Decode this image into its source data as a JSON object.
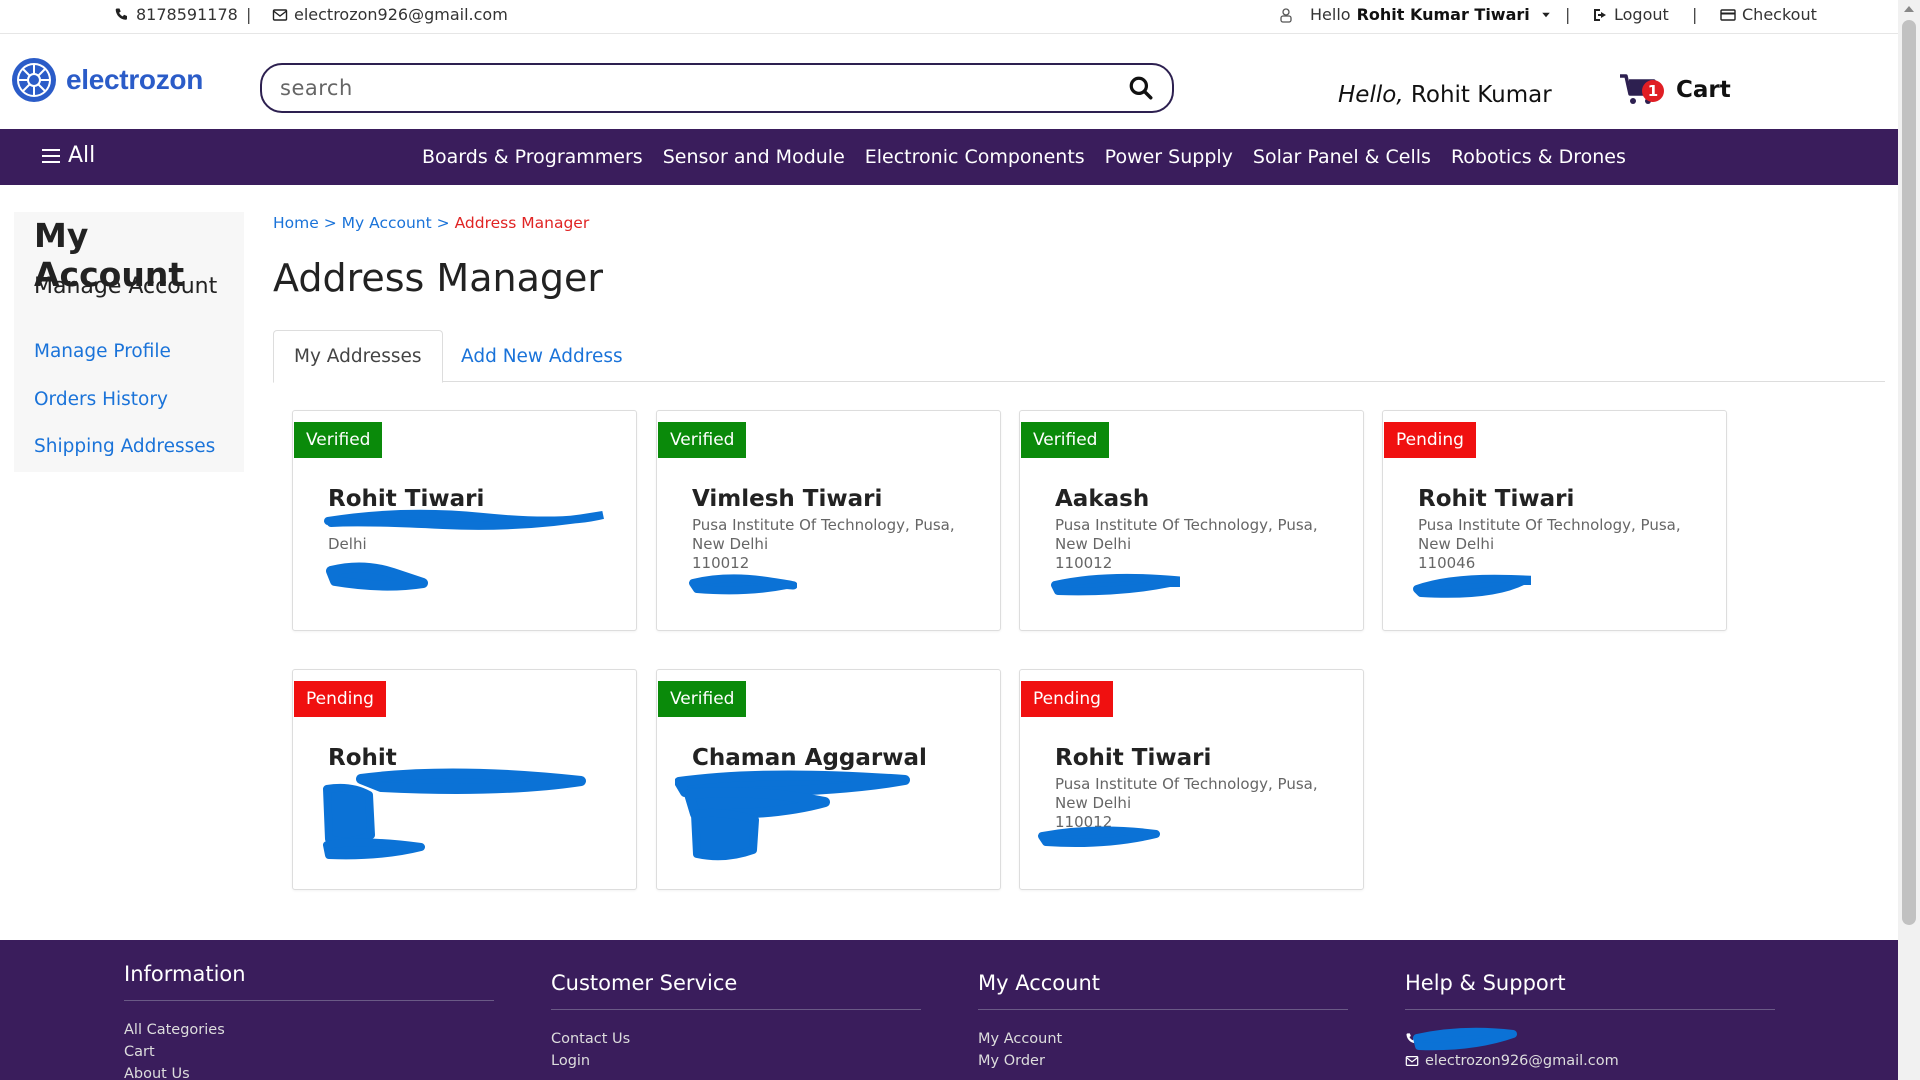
{
  "topbar": {
    "phone": "8178591178",
    "email": "electrozon926@gmail.com",
    "hello_prefix": "Hello",
    "user_name": "Rohit Kumar Tiwari",
    "logout": "Logout",
    "checkout": "Checkout"
  },
  "header": {
    "logo_text": "electrozon",
    "search_placeholder": "search",
    "hello_italic": "Hello,",
    "hello_name": "Rohit Kumar",
    "cart_count": "1",
    "cart_label": "Cart"
  },
  "nav": {
    "all_label": "All",
    "links": [
      "Boards & Programmers",
      "Sensor and Module",
      "Electronic Components",
      "Power Supply",
      "Solar Panel & Cells",
      "Robotics & Drones"
    ]
  },
  "sidebar": {
    "title": "My Account",
    "subtitle": "Manage Account",
    "links": [
      "Manage Profile",
      "Orders History",
      "Shipping Addresses"
    ]
  },
  "breadcrumb": {
    "home": "Home",
    "account": "My Account",
    "current": "Address Manager",
    "sep": ">"
  },
  "page_title": "Address Manager",
  "tabs": {
    "active": "My Addresses",
    "add": "Add New Address"
  },
  "addresses": [
    {
      "status": "Verified",
      "name": "Rohit Tiwari",
      "line1": "",
      "line2": "Delhi",
      "pin": ""
    },
    {
      "status": "Verified",
      "name": "Vimlesh Tiwari",
      "line1": "Pusa Institute Of Technology, Pusa,",
      "line2": "New Delhi",
      "pin": "110012"
    },
    {
      "status": "Verified",
      "name": "Aakash",
      "line1": "Pusa Institute Of Technology, Pusa,",
      "line2": "New Delhi",
      "pin": "110012"
    },
    {
      "status": "Pending",
      "name": "Rohit Tiwari",
      "line1": "Pusa Institute Of Technology, Pusa,",
      "line2": "New Delhi",
      "pin": "110046"
    },
    {
      "status": "Pending",
      "name": "Rohit",
      "line1": "",
      "line2": "",
      "pin": ""
    },
    {
      "status": "Verified",
      "name": "Chaman Aggarwal",
      "line1": "",
      "line2": "",
      "pin": ""
    },
    {
      "status": "Pending",
      "name": "Rohit Tiwari",
      "line1": "Pusa Institute Of Technology, Pusa,",
      "line2": "New Delhi",
      "pin": "110012"
    }
  ],
  "footer": {
    "information": {
      "title": "Information",
      "links": [
        "All Categories",
        "Cart",
        "About Us"
      ]
    },
    "customer_service": {
      "title": "Customer Service",
      "links": [
        "Contact Us",
        "Login"
      ]
    },
    "my_account": {
      "title": "My Account",
      "links": [
        "My Account",
        "My Order"
      ]
    },
    "help": {
      "title": "Help & Support",
      "email": "electrozon926@gmail.com"
    }
  },
  "colors": {
    "brand_purple": "#3a1d5c",
    "link_blue": "#1a73d9",
    "verified_green": "#0a8a0a",
    "pending_red": "#f01010",
    "redaction_blue": "#0b72d6"
  }
}
